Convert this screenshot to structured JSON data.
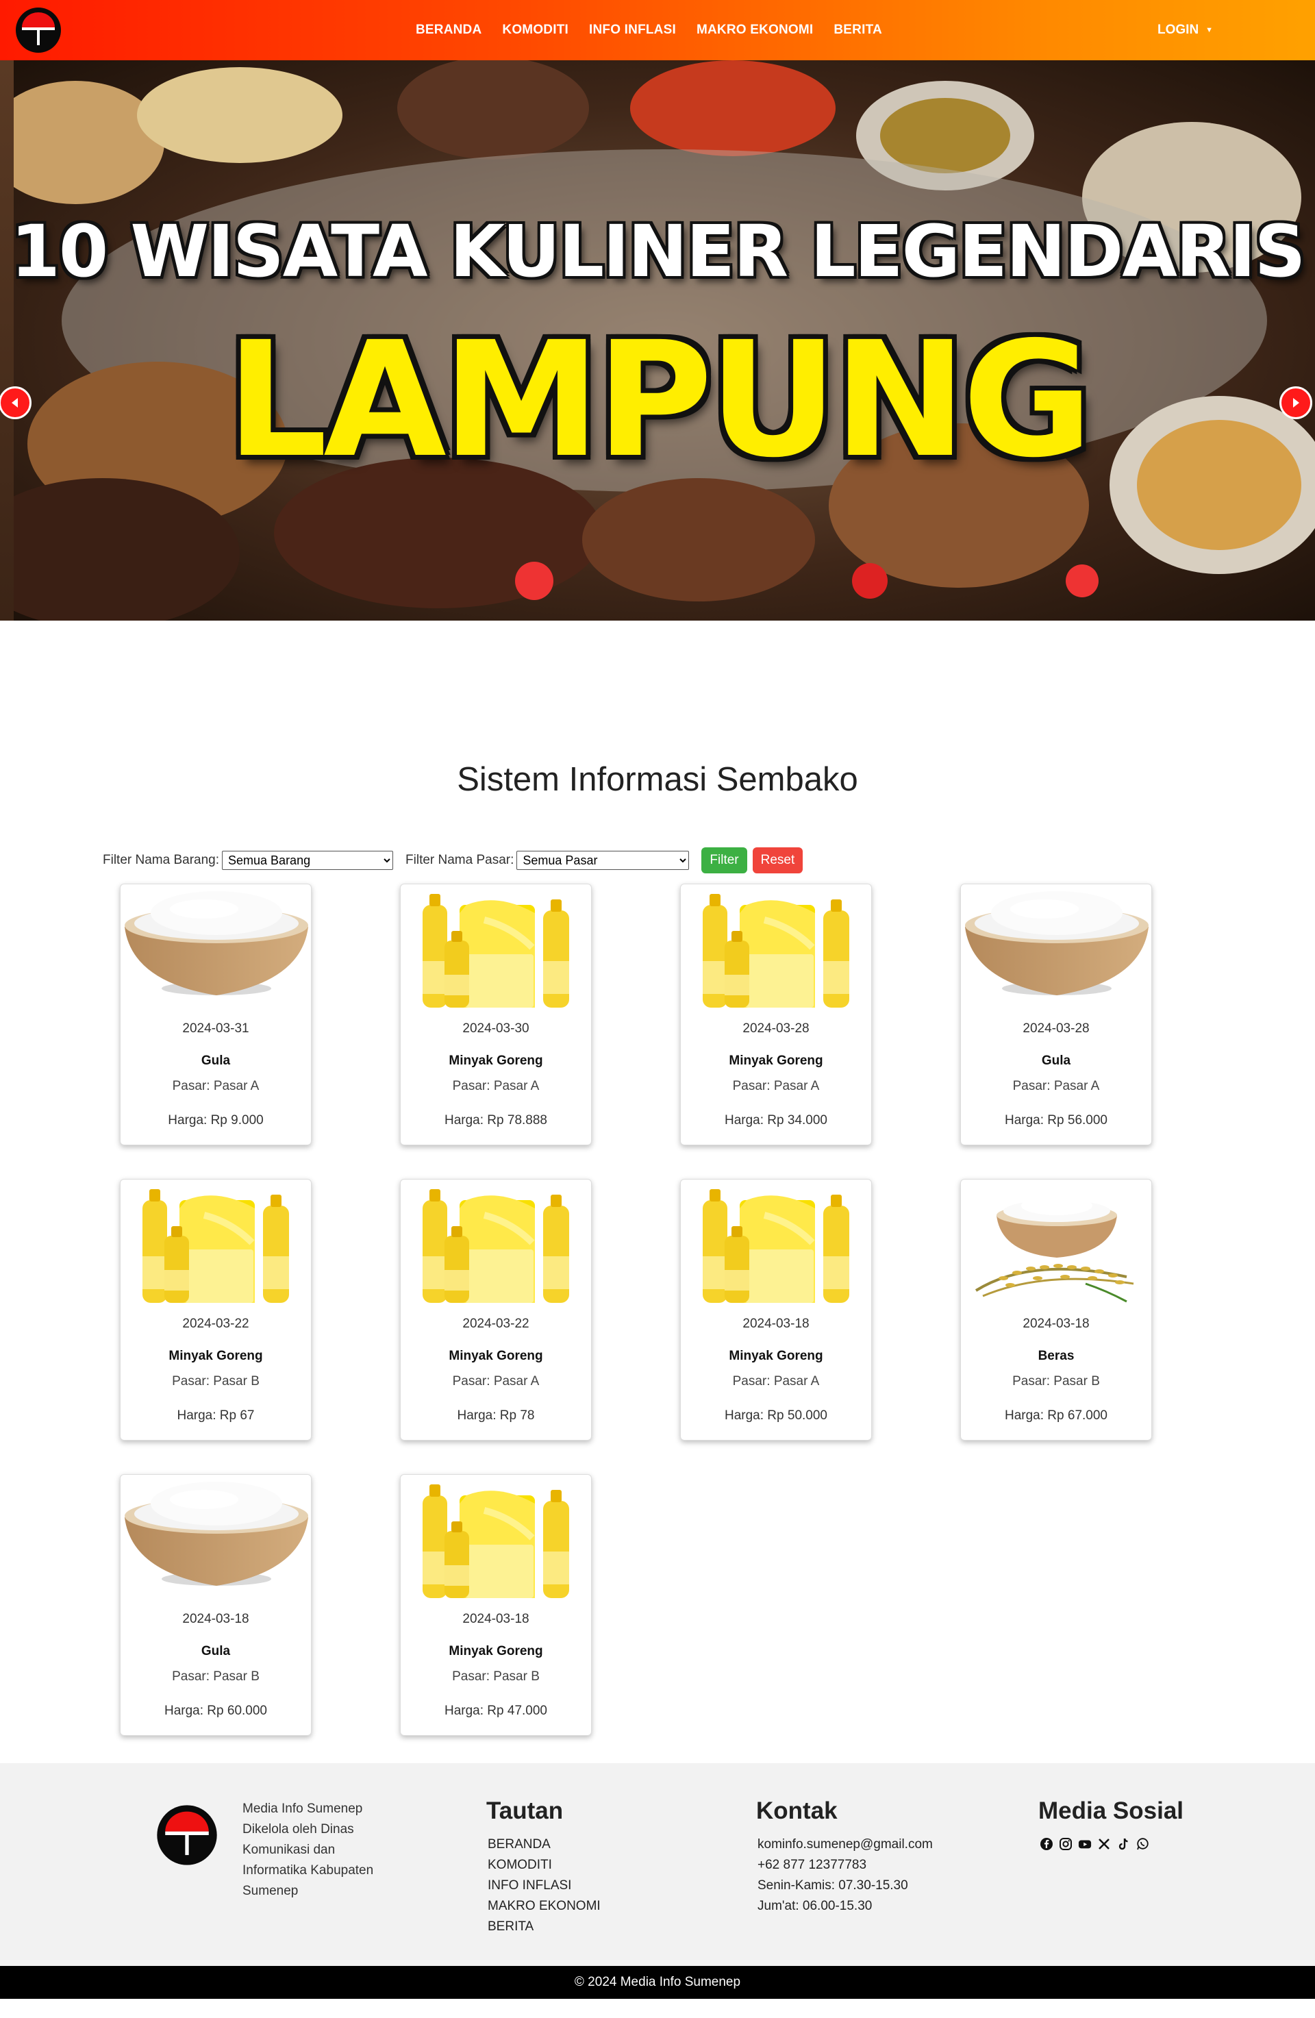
{
  "nav": {
    "links": [
      "BERANDA",
      "KOMODITI",
      "INFO INFLASI",
      "MAKRO EKONOMI",
      "BERITA"
    ],
    "login": "LOGIN"
  },
  "hero": {
    "line1": "10 WISATA KULINER LEGENDARIS",
    "line2": "LAMPUNG"
  },
  "page_title": "Sistem Informasi Sembako",
  "filters": {
    "barang_label": "Filter Nama Barang:",
    "barang_value": "Semua Barang",
    "pasar_label": "Filter Nama Pasar:",
    "pasar_value": "Semua Pasar",
    "filter_btn": "Filter",
    "reset_btn": "Reset"
  },
  "products": [
    {
      "date": "2024-03-31",
      "name": "Gula",
      "pasar": "Pasar: Pasar A",
      "harga": "Harga: Rp 9.000",
      "image": "sugar-bowl"
    },
    {
      "date": "2024-03-30",
      "name": "Minyak Goreng",
      "pasar": "Pasar: Pasar A",
      "harga": "Harga: Rp 78.888",
      "image": "cooking-oil"
    },
    {
      "date": "2024-03-28",
      "name": "Minyak Goreng",
      "pasar": "Pasar: Pasar A",
      "harga": "Harga: Rp 34.000",
      "image": "cooking-oil"
    },
    {
      "date": "2024-03-28",
      "name": "Gula",
      "pasar": "Pasar: Pasar A",
      "harga": "Harga: Rp 56.000",
      "image": "sugar-bowl"
    },
    {
      "date": "2024-03-22",
      "name": "Minyak Goreng",
      "pasar": "Pasar: Pasar B",
      "harga": "Harga: Rp 67",
      "image": "cooking-oil"
    },
    {
      "date": "2024-03-22",
      "name": "Minyak Goreng",
      "pasar": "Pasar: Pasar A",
      "harga": "Harga: Rp 78",
      "image": "cooking-oil"
    },
    {
      "date": "2024-03-18",
      "name": "Minyak Goreng",
      "pasar": "Pasar: Pasar A",
      "harga": "Harga: Rp 50.000",
      "image": "cooking-oil"
    },
    {
      "date": "2024-03-18",
      "name": "Beras",
      "pasar": "Pasar: Pasar B",
      "harga": "Harga: Rp 67.000",
      "image": "rice-bowl"
    },
    {
      "date": "2024-03-18",
      "name": "Gula",
      "pasar": "Pasar: Pasar B",
      "harga": "Harga: Rp 60.000",
      "image": "sugar-bowl"
    },
    {
      "date": "2024-03-18",
      "name": "Minyak Goreng",
      "pasar": "Pasar: Pasar B",
      "harga": "Harga: Rp 47.000",
      "image": "cooking-oil"
    }
  ],
  "footer": {
    "about": "Media Info Sumenep Dikelola oleh Dinas Komunikasi dan Informatika Kabupaten Sumenep",
    "tautan_title": "Tautan",
    "tautan": [
      "BERANDA",
      "KOMODITI",
      "INFO INFLASI",
      "MAKRO EKONOMI",
      "BERITA"
    ],
    "kontak_title": "Kontak",
    "kontak": [
      "kominfo.sumenep@gmail.com",
      "+62 877 12377783",
      "Senin-Kamis: 07.30-15.30",
      "Jum'at: 06.00-15.30"
    ],
    "sosial_title": "Media Sosial",
    "sosial_icons": [
      "facebook-icon",
      "instagram-icon",
      "youtube-icon",
      "x-icon",
      "tiktok-icon",
      "whatsapp-icon"
    ],
    "copyright": "© 2024 Media Info Sumenep"
  },
  "colors": {
    "nav_start": "#ff1a00",
    "nav_end": "#ffa100",
    "filter_btn": "#3cb043",
    "reset_btn": "#f0443b",
    "footer_bg": "#f2f2f2",
    "copyright_bg": "#000000"
  }
}
